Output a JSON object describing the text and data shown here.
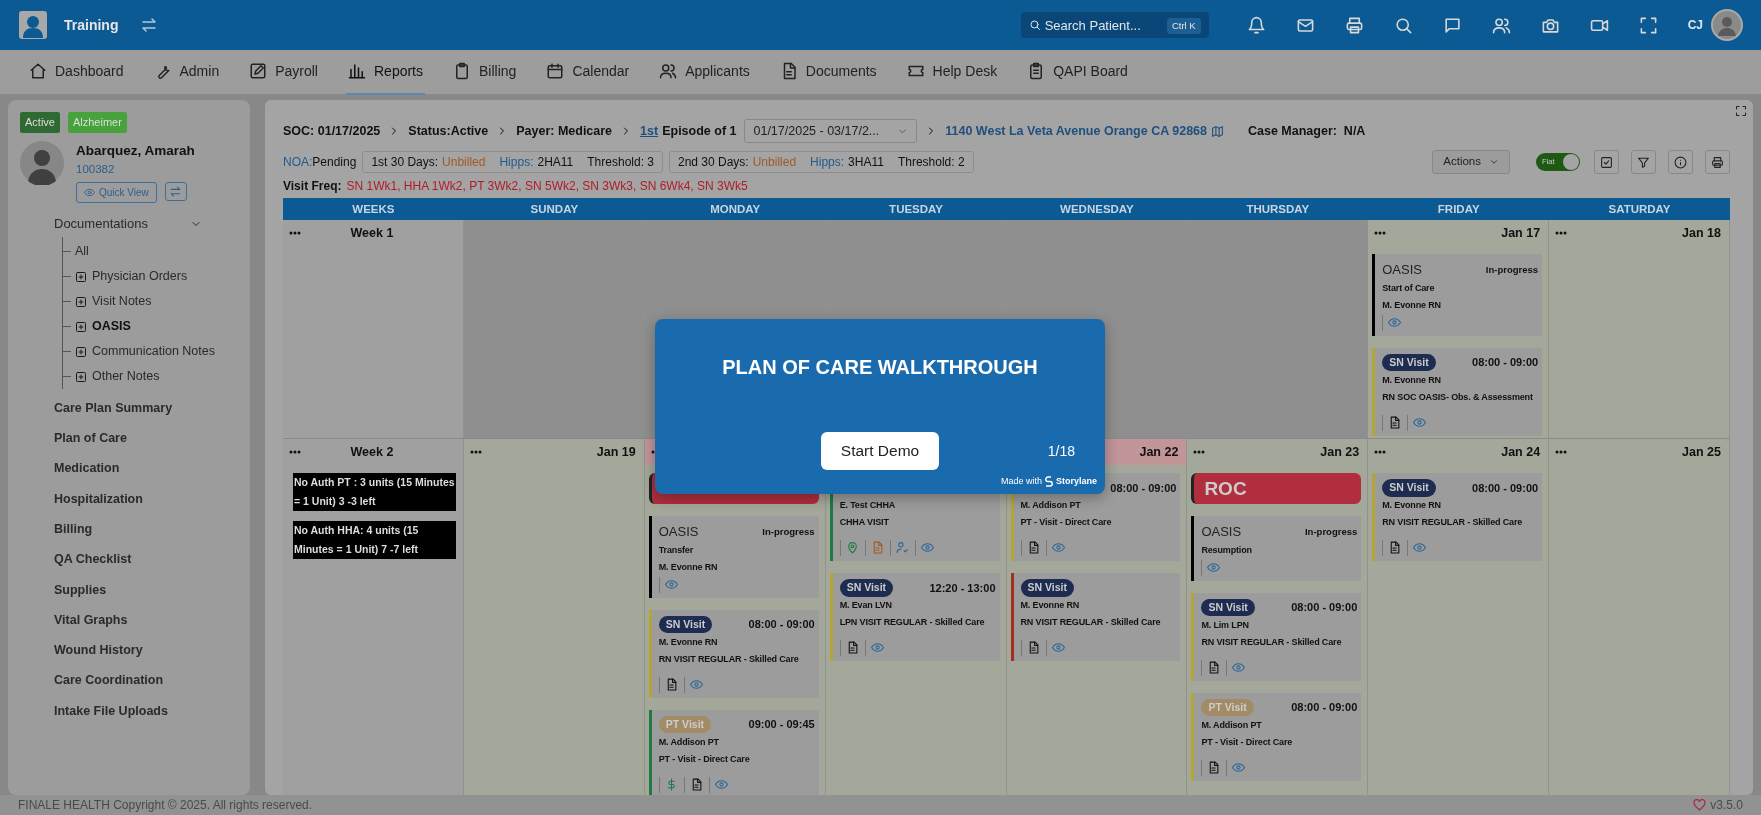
{
  "topbar": {
    "app_name": "Training",
    "search_placeholder": "Search Patient...",
    "search_shortcut": "Ctrl K",
    "user_initials": "CJ"
  },
  "nav": [
    {
      "label": "Dashboard",
      "selected": false
    },
    {
      "label": "Admin",
      "selected": false
    },
    {
      "label": "Payroll",
      "selected": false
    },
    {
      "label": "Reports",
      "selected": true
    },
    {
      "label": "Billing",
      "selected": false
    },
    {
      "label": "Calendar",
      "selected": false
    },
    {
      "label": "Applicants",
      "selected": false
    },
    {
      "label": "Documents",
      "selected": false
    },
    {
      "label": "Help Desk",
      "selected": false
    },
    {
      "label": "QAPI Board",
      "selected": false
    }
  ],
  "sidebar": {
    "tags": [
      {
        "label": "Active",
        "color": "#2f6a33"
      },
      {
        "label": "Alzheimer",
        "color": "#47a23c"
      }
    ],
    "patient": {
      "name": "Abarquez, Amarah",
      "id": "100382",
      "quick_view": "Quick View"
    },
    "documentations": {
      "label": "Documentations",
      "expanded": true,
      "children": [
        {
          "label": "All",
          "kind": "link",
          "selected": false
        },
        {
          "label": "Physician Orders",
          "kind": "folder",
          "selected": false
        },
        {
          "label": "Visit Notes",
          "kind": "folder",
          "selected": false
        },
        {
          "label": "OASIS",
          "kind": "folder",
          "selected": true
        },
        {
          "label": "Communication Notes",
          "kind": "folder",
          "selected": false
        },
        {
          "label": "Other Notes",
          "kind": "folder",
          "selected": false
        }
      ]
    },
    "items": [
      "Care Plan Summary",
      "Plan of Care",
      "Medication",
      "Hospitalization",
      "Billing",
      "QA Checklist",
      "Supplies",
      "Vital Graphs",
      "Wound History",
      "Care Coordination",
      "Intake File Uploads"
    ]
  },
  "episode": {
    "crumbs": [
      "SOC: 01/17/2025",
      "Status:Active",
      "Payer: Medicare"
    ],
    "episode_link": "1st",
    "episode_text": "Episode of 1",
    "range": "01/17/2025 - 03/17/2...",
    "address": "1140 West La Veta Avenue Orange CA 92868",
    "case_manager": "Case Manager:  N/A",
    "noa_label": "NOA:",
    "noa_value": "Pending",
    "periods": [
      {
        "period": "1st 30 Days:",
        "status": "Unbilled",
        "hipps_label": "Hipps:",
        "hipps": "2HA11",
        "threshold": "Threshold: 3"
      },
      {
        "period": "2nd 30 Days:",
        "status": "Unbilled",
        "hipps_label": "Hipps:",
        "hipps": "3HA11",
        "threshold": "Threshold: 2"
      }
    ],
    "actions": "Actions",
    "flat": {
      "label": "Flat",
      "on": true
    },
    "visit_freq_label": "Visit Freq:",
    "visit_freq": "SN 1Wk1, HHA 1Wk2, PT 3Wk2, SN 5Wk2, SN 3Wk3, SN 6Wk4, SN 3Wk5"
  },
  "calendar": {
    "columns": [
      "WEEKS",
      "SUNDAY",
      "MONDAY",
      "TUESDAY",
      "WEDNESDAY",
      "THURSDAY",
      "FRIDAY",
      "SATURDAY"
    ],
    "weeks": [
      {
        "label": "Week 1",
        "days": [
          {
            "in_episode": false
          },
          {
            "in_episode": false
          },
          {
            "in_episode": false
          },
          {
            "in_episode": false
          },
          {
            "in_episode": false
          },
          {
            "in_episode": true,
            "date": "Jan 17",
            "highlighted": false,
            "cards": [
              {
                "kind": "oasis",
                "title": "OASIS",
                "status": "In-progress",
                "type": "Start of Care",
                "clinician": "M. Evonne RN",
                "color": "#000000",
                "tools": [
                  {
                    "kind": "view"
                  }
                ]
              },
              {
                "kind": "visit",
                "badge": {
                  "label": "SN Visit",
                  "color": "#1e2c52"
                },
                "time": "08:00 - 09:00",
                "clinician": "M. Evonne RN",
                "service": "RN SOC OASIS- Obs. & Assessment",
                "color": "#b3a636",
                "tools": [
                  {
                    "kind": "document"
                  },
                  {
                    "kind": "view"
                  }
                ]
              }
            ]
          },
          {
            "in_episode": true,
            "date": "Jan 18",
            "highlighted": false
          }
        ]
      },
      {
        "label": "Week 2",
        "notes": [
          "No Auth PT : 3 units (15 Minutes = 1 Unit) 3 -3 left",
          "No Auth HHA: 4 units (15 Minutes = 1 Unit) 7 -7 left"
        ],
        "days": [
          {
            "in_episode": true,
            "date": "Jan 19",
            "highlighted": false
          },
          {
            "in_episode": true,
            "highlighted": true,
            "cards": [
              {
                "kind": "banner",
                "color": "#b02e3e"
              },
              {
                "kind": "oasis",
                "title": "OASIS",
                "status": "In-progress",
                "type": "Transfer",
                "clinician": "M. Evonne RN",
                "color": "#000000",
                "tools": [
                  {
                    "kind": "view"
                  }
                ]
              },
              {
                "kind": "visit",
                "badge": {
                  "label": "SN Visit",
                  "color": "#1e2c52"
                },
                "time": "08:00 - 09:00",
                "clinician": "M. Evonne RN",
                "service": "RN VISIT REGULAR - Skilled Care",
                "color": "#b3a636",
                "tools": [
                  {
                    "kind": "document"
                  },
                  {
                    "kind": "view"
                  }
                ]
              },
              {
                "kind": "visit",
                "badge": {
                  "label": "PT Visit",
                  "color": "#a38b65"
                },
                "time": "09:00 - 09:45",
                "clinician": "M. Addison PT",
                "service": "PT - Visit - Direct Care",
                "color": "#1f7a45",
                "tools": [
                  {
                    "kind": "billing"
                  },
                  {
                    "kind": "document"
                  },
                  {
                    "kind": "view"
                  }
                ]
              }
            ]
          },
          {
            "in_episode": true,
            "highlighted": false,
            "cards": [
              {
                "kind": "visit",
                "clinician": "E. Test CHHA",
                "service": "CHHA VISIT",
                "color": "#1f7a45",
                "tools": [
                  {
                    "kind": "location"
                  },
                  {
                    "kind": "file"
                  },
                  {
                    "kind": "assign"
                  },
                  {
                    "kind": "view"
                  }
                ]
              },
              {
                "kind": "visit",
                "badge": {
                  "label": "SN Visit",
                  "color": "#1e2c52"
                },
                "time": "12:20 - 13:00",
                "clinician": "M. Evan LVN",
                "service": "LPN VISIT REGULAR - Skilled Care",
                "color": "#b3a636",
                "tools": [
                  {
                    "kind": "document"
                  },
                  {
                    "kind": "view"
                  }
                ]
              }
            ]
          },
          {
            "in_episode": true,
            "date": "Jan 22",
            "highlighted": true,
            "cards": [
              {
                "kind": "visit",
                "time": "08:00 - 09:00",
                "clinician": "M. Addison PT",
                "service": "PT - Visit - Direct Care",
                "color": "#b3a636",
                "tools": [
                  {
                    "kind": "document"
                  },
                  {
                    "kind": "view"
                  }
                ]
              },
              {
                "kind": "visit",
                "badge": {
                  "label": "SN Visit",
                  "color": "#1e2c52"
                },
                "clinician": "M. Evonne RN",
                "service": "RN VISIT REGULAR - Skilled Care",
                "color": "#a3301f",
                "tools": [
                  {
                    "kind": "document"
                  },
                  {
                    "kind": "view"
                  }
                ]
              }
            ]
          },
          {
            "in_episode": true,
            "date": "Jan 23",
            "highlighted": false,
            "cards": [
              {
                "kind": "banner",
                "label": "ROC",
                "color": "#b02e3e"
              },
              {
                "kind": "oasis",
                "title": "OASIS",
                "status": "In-progress",
                "type": "Resumption",
                "color": "#000000",
                "tools": [
                  {
                    "kind": "view"
                  }
                ]
              },
              {
                "kind": "visit",
                "badge": {
                  "label": "SN Visit",
                  "color": "#1e2c52"
                },
                "time": "08:00 - 09:00",
                "clinician": "M. Lim LPN",
                "service": "RN VISIT REGULAR - Skilled Care",
                "color": "#b3a636",
                "tools": [
                  {
                    "kind": "document"
                  },
                  {
                    "kind": "view"
                  }
                ]
              },
              {
                "kind": "visit",
                "badge": {
                  "label": "PT Visit",
                  "color": "#a38b65"
                },
                "time": "08:00 - 09:00",
                "clinician": "M. Addison PT",
                "service": "PT - Visit - Direct Care",
                "color": "#b3a636",
                "tools": [
                  {
                    "kind": "document"
                  },
                  {
                    "kind": "view"
                  }
                ]
              }
            ]
          },
          {
            "in_episode": true,
            "date": "Jan 24",
            "highlighted": false,
            "cards": [
              {
                "kind": "visit",
                "badge": {
                  "label": "SN Visit",
                  "color": "#1e2c52"
                },
                "time": "08:00 - 09:00",
                "clinician": "M. Evonne RN",
                "service": "RN VISIT REGULAR - Skilled Care",
                "color": "#b3a636",
                "tools": [
                  {
                    "kind": "document"
                  },
                  {
                    "kind": "view"
                  }
                ]
              }
            ]
          },
          {
            "in_episode": true,
            "date": "Jan 25",
            "highlighted": false
          }
        ]
      }
    ]
  },
  "modal": {
    "title": "PLAN OF CARE WALKTHROUGH",
    "button": "Start Demo",
    "step": "1/18",
    "credit": "Made with",
    "brand": "Storylane"
  },
  "footer": {
    "copyright": "FINALE HEALTH Copyright © 2025. All rights reserved.",
    "version": "v3.5.0"
  }
}
